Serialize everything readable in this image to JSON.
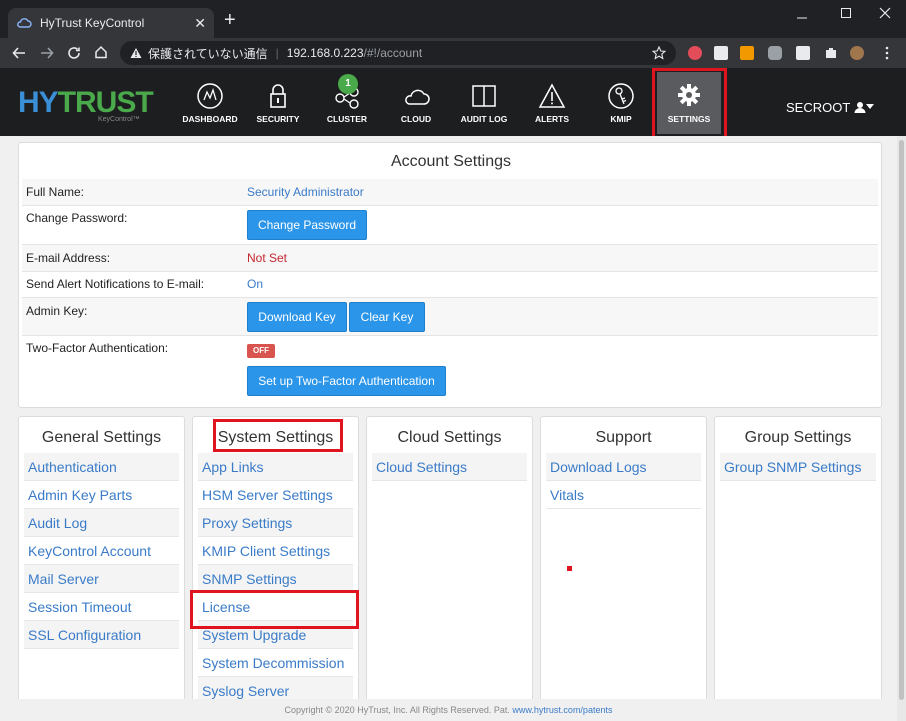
{
  "browser": {
    "tab_title": "HyTrust KeyControl",
    "tab_close": "✕",
    "new_tab": "+",
    "security_label": "保護されていない通信",
    "url_host": "192.168.0.223",
    "url_path": "/#!/account"
  },
  "header": {
    "logo_hy": "HY",
    "logo_trust": "TRUST",
    "logo_sub": "KeyControl™",
    "nav": [
      {
        "label": "DASHBOARD"
      },
      {
        "label": "SECURITY"
      },
      {
        "label": "CLUSTER"
      },
      {
        "label": "CLOUD"
      },
      {
        "label": "AUDIT LOG"
      },
      {
        "label": "ALERTS"
      },
      {
        "label": "KMIP"
      },
      {
        "label": "SETTINGS"
      }
    ],
    "cluster_badge": "1",
    "user": "SECROOT"
  },
  "account": {
    "title": "Account Settings",
    "full_name_label": "Full Name:",
    "full_name_value": "Security Administrator",
    "change_password_label": "Change Password:",
    "change_password_button": "Change Password",
    "email_label": "E-mail Address:",
    "email_value": "Not Set",
    "alert_label": "Send Alert Notifications to E-mail:",
    "alert_value": "On",
    "admin_key_label": "Admin Key:",
    "download_key_button": "Download Key",
    "clear_key_button": "Clear Key",
    "twofactor_label": "Two-Factor Authentication:",
    "twofactor_status": "OFF",
    "twofactor_button": "Set up Two-Factor Authentication"
  },
  "columns": {
    "general": {
      "title": "General Settings",
      "items": [
        "Authentication",
        "Admin Key Parts",
        "Audit Log",
        "KeyControl Account",
        "Mail Server",
        "Session Timeout",
        "SSL Configuration"
      ]
    },
    "system": {
      "title": "System Settings",
      "items": [
        "App Links",
        "HSM Server Settings",
        "Proxy Settings",
        "KMIP Client Settings",
        "SNMP Settings",
        "License",
        "System Upgrade",
        "System Decommission",
        "Syslog Server"
      ]
    },
    "cloud": {
      "title": "Cloud Settings",
      "items": [
        "Cloud Settings"
      ]
    },
    "support": {
      "title": "Support",
      "items": [
        "Download Logs",
        "Vitals"
      ]
    },
    "group": {
      "title": "Group Settings",
      "items": [
        "Group SNMP Settings"
      ]
    }
  },
  "footer": {
    "text": "Copyright © 2020 HyTrust, Inc. All Rights Reserved. Pat. ",
    "link": "www.hytrust.com/patents"
  },
  "colors": {
    "accent": "#2b95e9",
    "highlight": "#e0141e",
    "link": "#3a7bc8"
  }
}
